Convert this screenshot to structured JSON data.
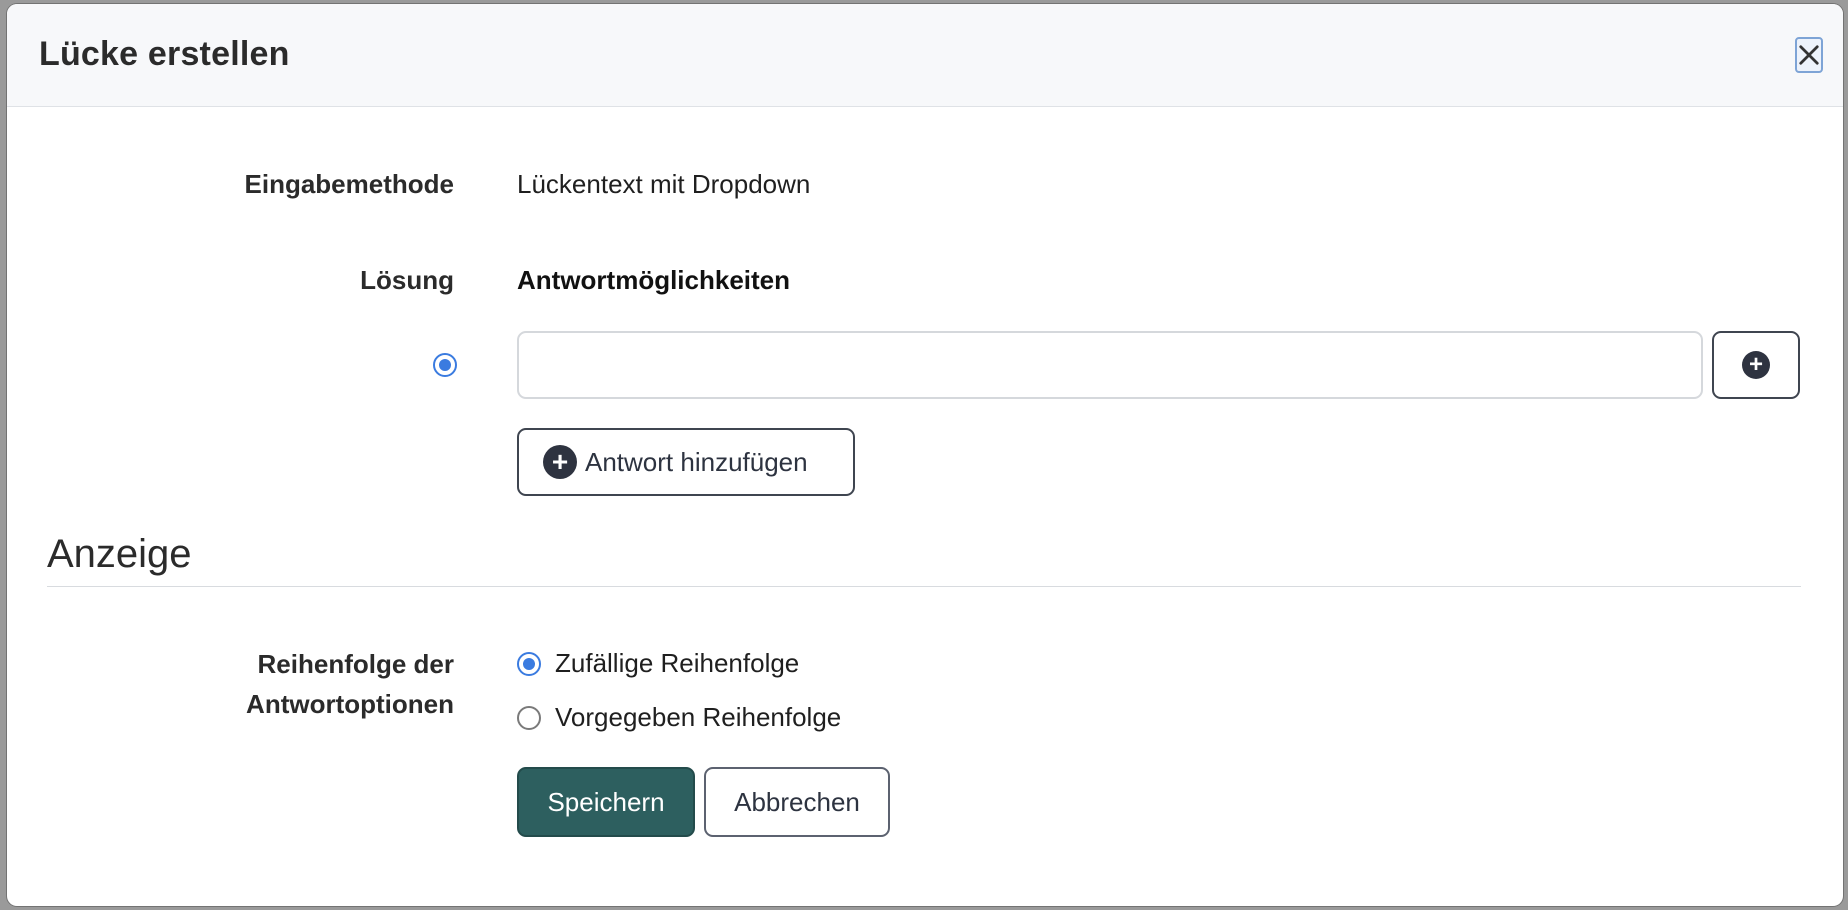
{
  "modal": {
    "title": "Lücke erstellen",
    "close_icon": "close-icon"
  },
  "form": {
    "input_method_label": "Eingabemethode",
    "input_method_value": "Lückentext mit Dropdown",
    "solution_label": "Lösung",
    "answer_options_header": "Antwortmöglichkeiten",
    "answers": [
      {
        "value": "",
        "placeholder": "",
        "is_solution": true
      }
    ],
    "add_answer_label": "Antwort hinzufügen"
  },
  "display_section": {
    "title": "Anzeige",
    "order_label_line1": "Reihenfolge der",
    "order_label_line2": "Antwortoptionen",
    "order_options": [
      {
        "label": "Zufällige Reihenfolge",
        "selected": true
      },
      {
        "label": "Vorgegeben Reihenfolge",
        "selected": false
      }
    ]
  },
  "actions": {
    "save_label": "Speichern",
    "cancel_label": "Abbrechen"
  },
  "colors": {
    "primary": "#2d5f5f",
    "radio_accent": "#3a7be0",
    "header_bg": "#f7f8fa"
  }
}
